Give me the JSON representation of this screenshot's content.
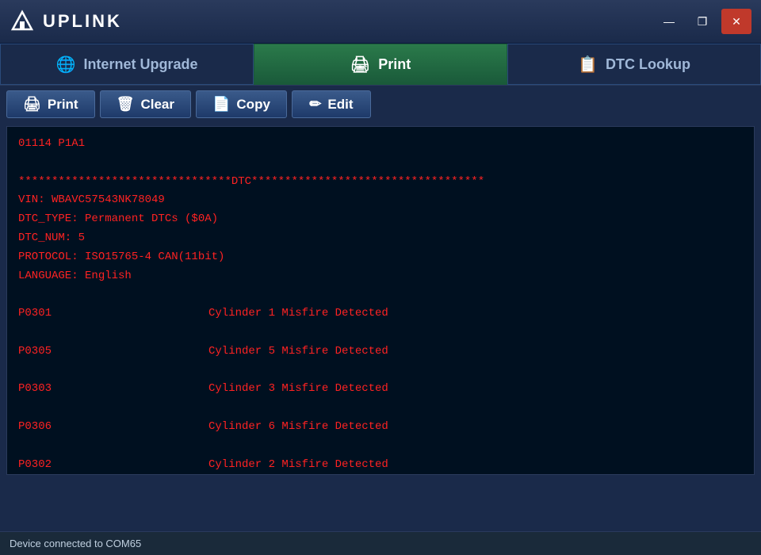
{
  "app": {
    "title": "UPLINK",
    "logo_icon": "▲"
  },
  "window_controls": {
    "minimize_label": "—",
    "restore_label": "❐",
    "close_label": "✕"
  },
  "tabs": [
    {
      "id": "internet-upgrade",
      "icon": "🌐",
      "label": "Internet Upgrade",
      "active": false
    },
    {
      "id": "print",
      "icon": "🖨",
      "label": "Print",
      "active": true
    },
    {
      "id": "dtc-lookup",
      "icon": "📋",
      "label": "DTC Lookup",
      "active": false
    }
  ],
  "toolbar": {
    "print_label": "Print",
    "clear_label": "Clear",
    "copy_label": "Copy",
    "edit_label": "Edit"
  },
  "content": {
    "header_line": "********************************DTC***********************************",
    "vin_line": "VIN: WBAVC57543NK78049",
    "dtc_type_line": "DTC_TYPE: Permanent DTCs ($0A)",
    "dtc_num_line": "DTC_NUM: 5",
    "protocol_line": "PROTOCOL: ISO15765-4 CAN(11bit)",
    "language_line": "LANGUAGE: English",
    "prefix_line": "01114        P1A1",
    "entries": [
      {
        "code": "P0301",
        "description": "Cylinder 1 Misfire Detected"
      },
      {
        "code": "P0305",
        "description": "Cylinder 5 Misfire Detected"
      },
      {
        "code": "P0303",
        "description": "Cylinder 3 Misfire Detected"
      },
      {
        "code": "P0306",
        "description": "Cylinder 6 Misfire Detected"
      },
      {
        "code": "P0302",
        "description": "Cylinder 2 Misfire Detected"
      }
    ]
  },
  "status": {
    "text": "Device connected to COM65"
  }
}
